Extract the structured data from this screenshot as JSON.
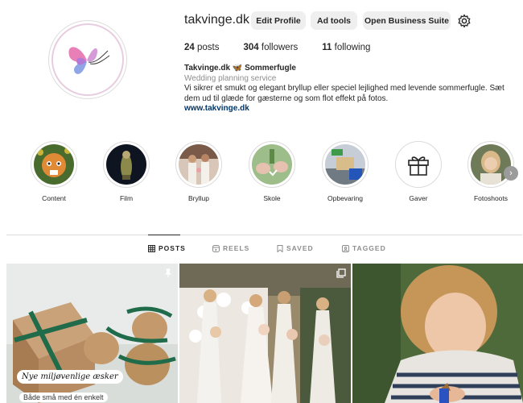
{
  "profile": {
    "username": "takvinge.dk",
    "edit_profile": "Edit Profile",
    "ad_tools": "Ad tools",
    "business_suite": "Open Business Suite",
    "posts_count": "24",
    "posts_label": "posts",
    "followers_count": "304",
    "followers_label": "followers",
    "following_count": "11",
    "following_label": "following"
  },
  "bio": {
    "name": "Takvinge.dk 🦋 Sommerfugle",
    "category": "Wedding planning service",
    "text": "Vi sikrer et smukt og elegant bryllup eller speciel lejlighed med levende sommerfugle. Sæt dem ud til glæde for gæsterne og som flot effekt på fotos.",
    "link": "www.takvinge.dk"
  },
  "highlights": [
    {
      "label": "Content"
    },
    {
      "label": "Film"
    },
    {
      "label": "Bryllup"
    },
    {
      "label": "Skole"
    },
    {
      "label": "Opbevaring"
    },
    {
      "label": "Gaver"
    },
    {
      "label": "Fotoshoots"
    }
  ],
  "tabs": {
    "posts": "POSTS",
    "reels": "REELS",
    "saved": "SAVED",
    "tagged": "TAGGED"
  },
  "posts": {
    "first_caption": "Nye miljøvenlige æsker",
    "first_sub": "Både små med én enkelt"
  },
  "colors": {
    "accent_link": "#00376b",
    "button_bg": "#efefef",
    "muted_text": "#8e8e8e"
  }
}
